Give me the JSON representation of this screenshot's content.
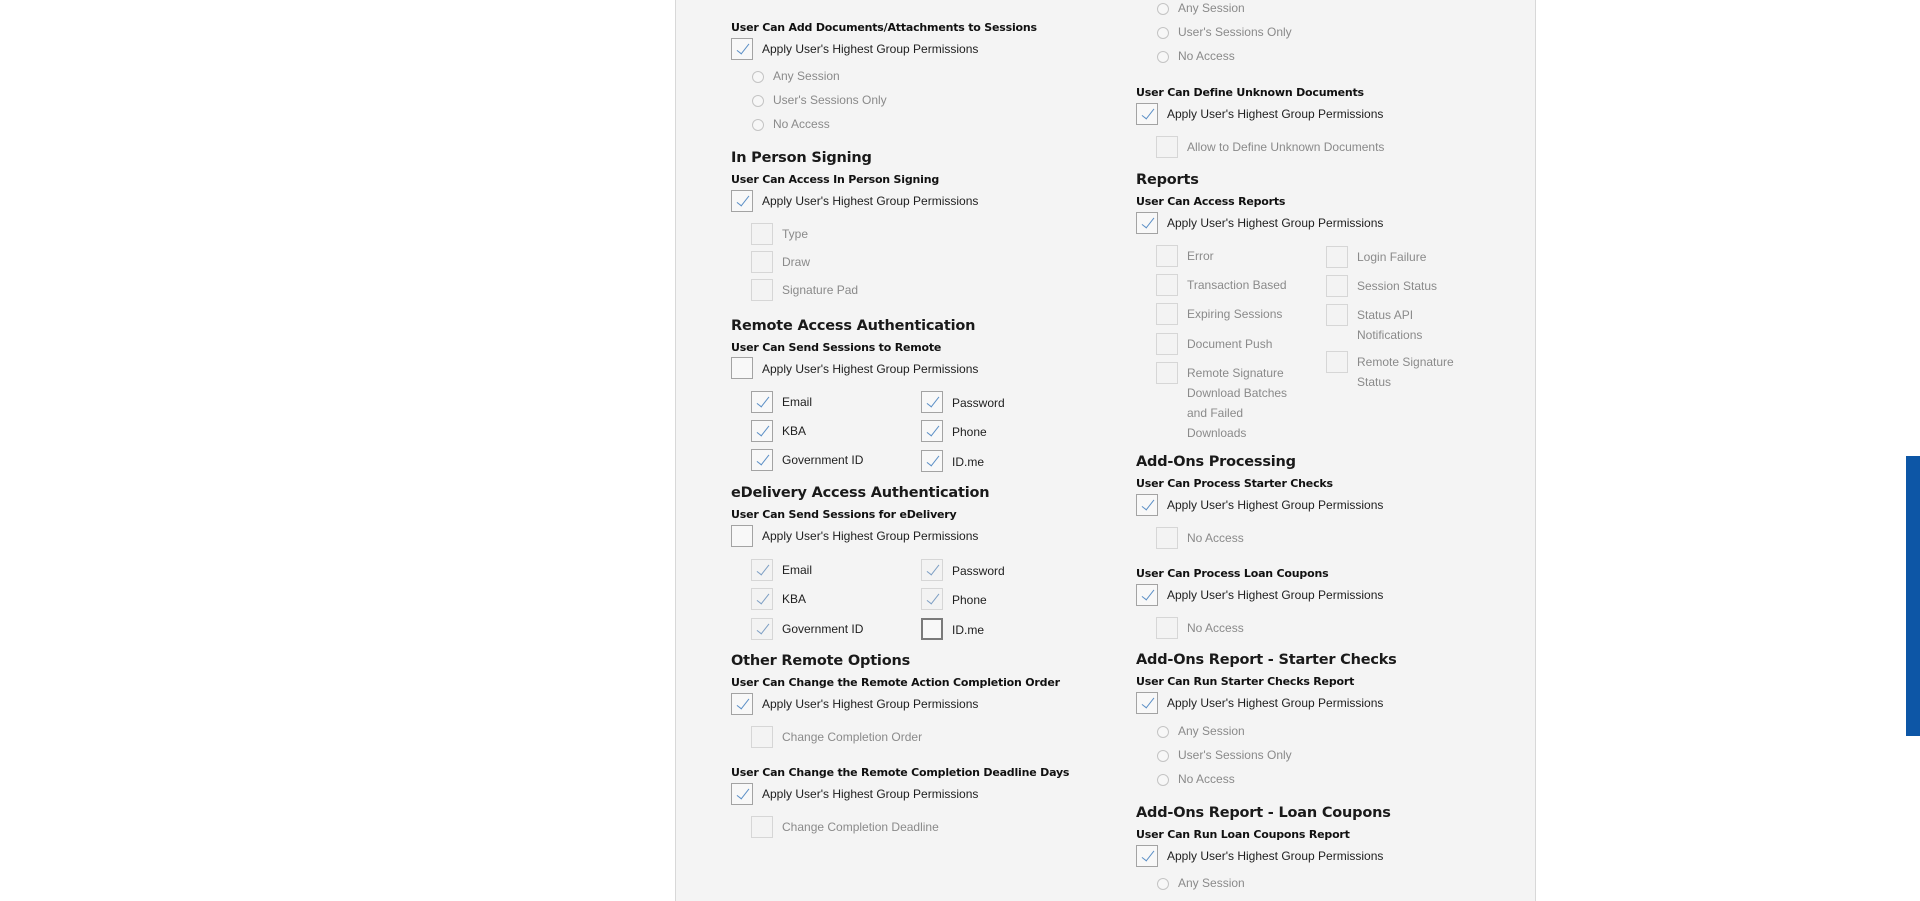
{
  "left": {
    "attach": {
      "title": "User Can Add Documents/Attachments to Sessions",
      "apply": "Apply User's Highest Group Permissions",
      "any": "Any Session",
      "users": "User's Sessions Only",
      "none": "No Access"
    },
    "in_person": {
      "heading": "In Person Signing",
      "title": "User Can Access In Person Signing",
      "apply": "Apply User's Highest Group Permissions",
      "type": "Type",
      "draw": "Draw",
      "pad": "Signature Pad"
    },
    "remote_auth": {
      "heading": "Remote Access Authentication",
      "title": "User Can Send Sessions to Remote",
      "apply": "Apply User's Highest Group Permissions",
      "email": "Email",
      "password": "Password",
      "kba": "KBA",
      "phone": "Phone",
      "gov": "Government ID",
      "idme": "ID.me"
    },
    "edelivery_auth": {
      "heading": "eDelivery Access Authentication",
      "title": "User Can Send Sessions for eDelivery",
      "apply": "Apply User's Highest Group Permissions",
      "email": "Email",
      "password": "Password",
      "kba": "KBA",
      "phone": "Phone",
      "gov": "Government ID",
      "idme": "ID.me"
    },
    "other_remote": {
      "heading": "Other Remote Options",
      "order_title": "User Can Change the Remote Action Completion Order",
      "apply1": "Apply User's Highest Group Permissions",
      "order_opt": "Change Completion Order",
      "deadline_title": "User Can Change the Remote Completion Deadline Days",
      "apply2": "Apply User's Highest Group Permissions",
      "deadline_opt": "Change Completion Deadline"
    }
  },
  "right": {
    "top_radios": {
      "any": "Any Session",
      "users": "User's Sessions Only",
      "none": "No Access"
    },
    "unknown_docs": {
      "title": "User Can Define Unknown Documents",
      "apply": "Apply User's Highest Group Permissions",
      "allow": "Allow to Define Unknown Documents"
    },
    "reports": {
      "heading": "Reports",
      "title": "User Can Access Reports",
      "apply": "Apply User's Highest Group Permissions",
      "error": "Error",
      "login_failure": "Login Failure",
      "transaction_based": "Transaction Based",
      "session_status": "Session Status",
      "expiring_sessions": "Expiring Sessions",
      "status_api": "Status API Notifications",
      "document_push": "Document Push",
      "remote_sig_status": "Remote Signature Status",
      "remote_sig_download": "Remote Signature Download Batches and Failed Downloads"
    },
    "addons_processing": {
      "heading": "Add-Ons Processing",
      "starter_title": "User Can Process Starter Checks",
      "apply1": "Apply User's Highest Group Permissions",
      "starter_none": "No Access",
      "loan_title": "User Can Process Loan Coupons",
      "apply2": "Apply User's Highest Group Permissions",
      "loan_none": "No Access"
    },
    "addons_starter_report": {
      "heading": "Add-Ons Report - Starter Checks",
      "title": "User Can Run Starter Checks Report",
      "apply": "Apply User's Highest Group Permissions",
      "any": "Any Session",
      "users": "User's Sessions Only",
      "none": "No Access"
    },
    "addons_loan_report": {
      "heading": "Add-Ons Report - Loan Coupons",
      "title": "User Can Run Loan Coupons Report",
      "apply": "Apply User's Highest Group Permissions",
      "any": "Any Session"
    }
  },
  "colors": {
    "panel_bg": "#f4f4f4",
    "check_mark": "#5b8fc6",
    "accent_scroll": "#0d56a6"
  }
}
